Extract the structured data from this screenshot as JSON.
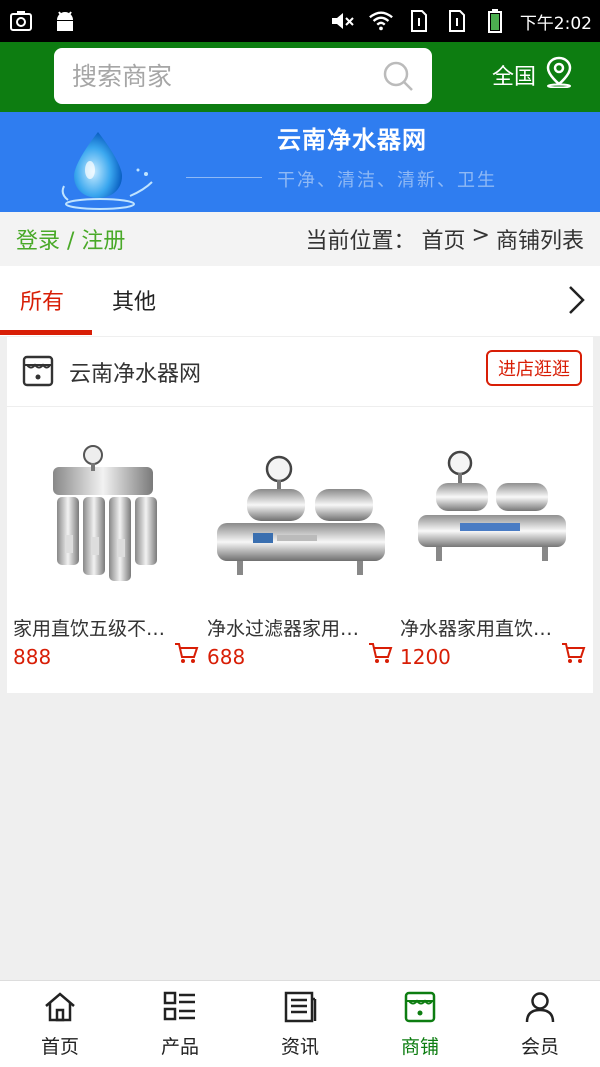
{
  "status": {
    "time": "下午2:02"
  },
  "search": {
    "placeholder": "搜索商家",
    "region": "全国"
  },
  "banner": {
    "title": "云南净水器网",
    "slogan": "干净、清洁、清新、卫生"
  },
  "crumbbar": {
    "login": "登录 / 注册",
    "label": "当前位置：",
    "home": "首页",
    "sep": ">",
    "current": "商铺列表"
  },
  "tabs": [
    {
      "label": "所有"
    },
    {
      "label": "其他"
    }
  ],
  "shop": {
    "name": "云南净水器网",
    "enter_label": "进店逛逛",
    "products": [
      {
        "name": "家用直饮五级不…",
        "price": "888"
      },
      {
        "name": "净水过滤器家用…",
        "price": "688"
      },
      {
        "name": "净水器家用直饮…",
        "price": "1200"
      }
    ]
  },
  "nav": [
    {
      "label": "首页",
      "icon": "home-icon"
    },
    {
      "label": "产品",
      "icon": "list-icon"
    },
    {
      "label": "资讯",
      "icon": "news-icon"
    },
    {
      "label": "商铺",
      "icon": "shop-icon"
    },
    {
      "label": "会员",
      "icon": "user-icon"
    }
  ],
  "colors": {
    "primary": "#0d7d11",
    "banner": "#2f7df0",
    "accent": "#d81e06",
    "login": "#49a928"
  }
}
